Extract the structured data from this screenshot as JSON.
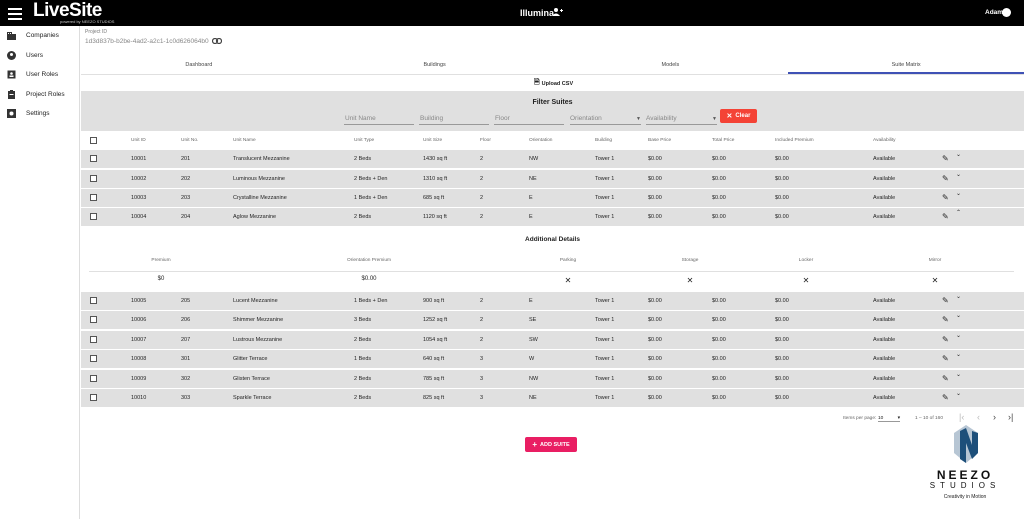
{
  "header": {
    "logo_text": "LiveSite",
    "logo_subtext": "powered by NEEZO STUDIOS",
    "project_name": "Illumina",
    "user_name": "Adam"
  },
  "sidebar": {
    "items": [
      {
        "label": "Companies",
        "icon": "building-icon"
      },
      {
        "label": "Users",
        "icon": "user-circle-icon"
      },
      {
        "label": "User Roles",
        "icon": "badge-icon"
      },
      {
        "label": "Project Roles",
        "icon": "clipboard-icon"
      },
      {
        "label": "Settings",
        "icon": "gear-icon"
      }
    ]
  },
  "project": {
    "id_label": "Project ID",
    "id_value": "1d3d837b-b2be-4ad2-a2c1-1c0d626064b0"
  },
  "tabs": [
    {
      "label": "Dashboard",
      "active": false
    },
    {
      "label": "Buildings",
      "active": false
    },
    {
      "label": "Models",
      "active": false
    },
    {
      "label": "Suite Matrix",
      "active": true
    }
  ],
  "upload_label": "Upload CSV",
  "filter": {
    "title": "Filter Suites",
    "unit_name": "Unit Name",
    "building": "Building",
    "floor": "Floor",
    "orientation": "Orientation",
    "availability": "Availability",
    "clear_label": "Clear"
  },
  "table": {
    "columns": [
      "Unit ID",
      "Unit No.",
      "Unit Name",
      "Unit Type",
      "Unit Size",
      "Floor",
      "Orientation",
      "Building",
      "Base Price",
      "Total Price",
      "Included Premium",
      "Availability"
    ],
    "rows": [
      {
        "id": "10001",
        "no": "201",
        "name": "Translucent Mezzanine",
        "type": "2 Beds",
        "size": "1430 sq ft",
        "floor": "2",
        "orientation": "NW",
        "building": "Tower 1",
        "base": "$0.00",
        "total": "$0.00",
        "premium": "$0.00",
        "availability": "Available",
        "chevron": "⌄"
      },
      {
        "id": "10002",
        "no": "202",
        "name": "Luminous Mezzanine",
        "type": "2 Beds + Den",
        "size": "1310 sq ft",
        "floor": "2",
        "orientation": "NE",
        "building": "Tower 1",
        "base": "$0.00",
        "total": "$0.00",
        "premium": "$0.00",
        "availability": "Available",
        "chevron": "⌄"
      },
      {
        "id": "10003",
        "no": "203",
        "name": "Crystalline Mezzanine",
        "type": "1 Beds + Den",
        "size": "685 sq ft",
        "floor": "2",
        "orientation": "E",
        "building": "Tower 1",
        "base": "$0.00",
        "total": "$0.00",
        "premium": "$0.00",
        "availability": "Available",
        "chevron": "⌄"
      },
      {
        "id": "10004",
        "no": "204",
        "name": "Aglow Mezzanine",
        "type": "2 Beds",
        "size": "1120 sq ft",
        "floor": "2",
        "orientation": "E",
        "building": "Tower 1",
        "base": "$0.00",
        "total": "$0.00",
        "premium": "$0.00",
        "availability": "Available",
        "chevron": "⌃"
      },
      {
        "id": "10005",
        "no": "205",
        "name": "Lucent Mezzanine",
        "type": "1 Beds + Den",
        "size": "900 sq ft",
        "floor": "2",
        "orientation": "E",
        "building": "Tower 1",
        "base": "$0.00",
        "total": "$0.00",
        "premium": "$0.00",
        "availability": "Available",
        "chevron": "⌄"
      },
      {
        "id": "10006",
        "no": "206",
        "name": "Shimmer Mezzanine",
        "type": "3 Beds",
        "size": "1252 sq ft",
        "floor": "2",
        "orientation": "SE",
        "building": "Tower 1",
        "base": "$0.00",
        "total": "$0.00",
        "premium": "$0.00",
        "availability": "Available",
        "chevron": "⌄"
      },
      {
        "id": "10007",
        "no": "207",
        "name": "Lustrous Mezzanine",
        "type": "2 Beds",
        "size": "1054 sq ft",
        "floor": "2",
        "orientation": "SW",
        "building": "Tower 1",
        "base": "$0.00",
        "total": "$0.00",
        "premium": "$0.00",
        "availability": "Available",
        "chevron": "⌄"
      },
      {
        "id": "10008",
        "no": "301",
        "name": "Glitter Terrace",
        "type": "1 Beds",
        "size": "640 sq ft",
        "floor": "3",
        "orientation": "W",
        "building": "Tower 1",
        "base": "$0.00",
        "total": "$0.00",
        "premium": "$0.00",
        "availability": "Available",
        "chevron": "⌄"
      },
      {
        "id": "10009",
        "no": "302",
        "name": "Glisten Terrace",
        "type": "2 Beds",
        "size": "785 sq ft",
        "floor": "3",
        "orientation": "NW",
        "building": "Tower 1",
        "base": "$0.00",
        "total": "$0.00",
        "premium": "$0.00",
        "availability": "Available",
        "chevron": "⌄"
      },
      {
        "id": "10010",
        "no": "303",
        "name": "Sparkle Terrace",
        "type": "2 Beds",
        "size": "825 sq ft",
        "floor": "3",
        "orientation": "NE",
        "building": "Tower 1",
        "base": "$0.00",
        "total": "$0.00",
        "premium": "$0.00",
        "availability": "Available",
        "chevron": "⌄"
      }
    ]
  },
  "details": {
    "title": "Additional Details",
    "columns": [
      "Premium",
      "Orientation Premium",
      "Parking",
      "Storage",
      "Locker",
      "Mirror"
    ],
    "values": [
      "$0",
      "$0.00",
      "✕",
      "✕",
      "✕",
      "✕"
    ]
  },
  "pagination": {
    "items_per_page_label": "Items per page:",
    "page_size": "10",
    "range": "1 – 10 of 160"
  },
  "add_suite_label": "ADD SUITE",
  "watermark": {
    "name": "NEEZO",
    "studios": "STUDIOS",
    "tagline": "Creativity in Motion"
  }
}
